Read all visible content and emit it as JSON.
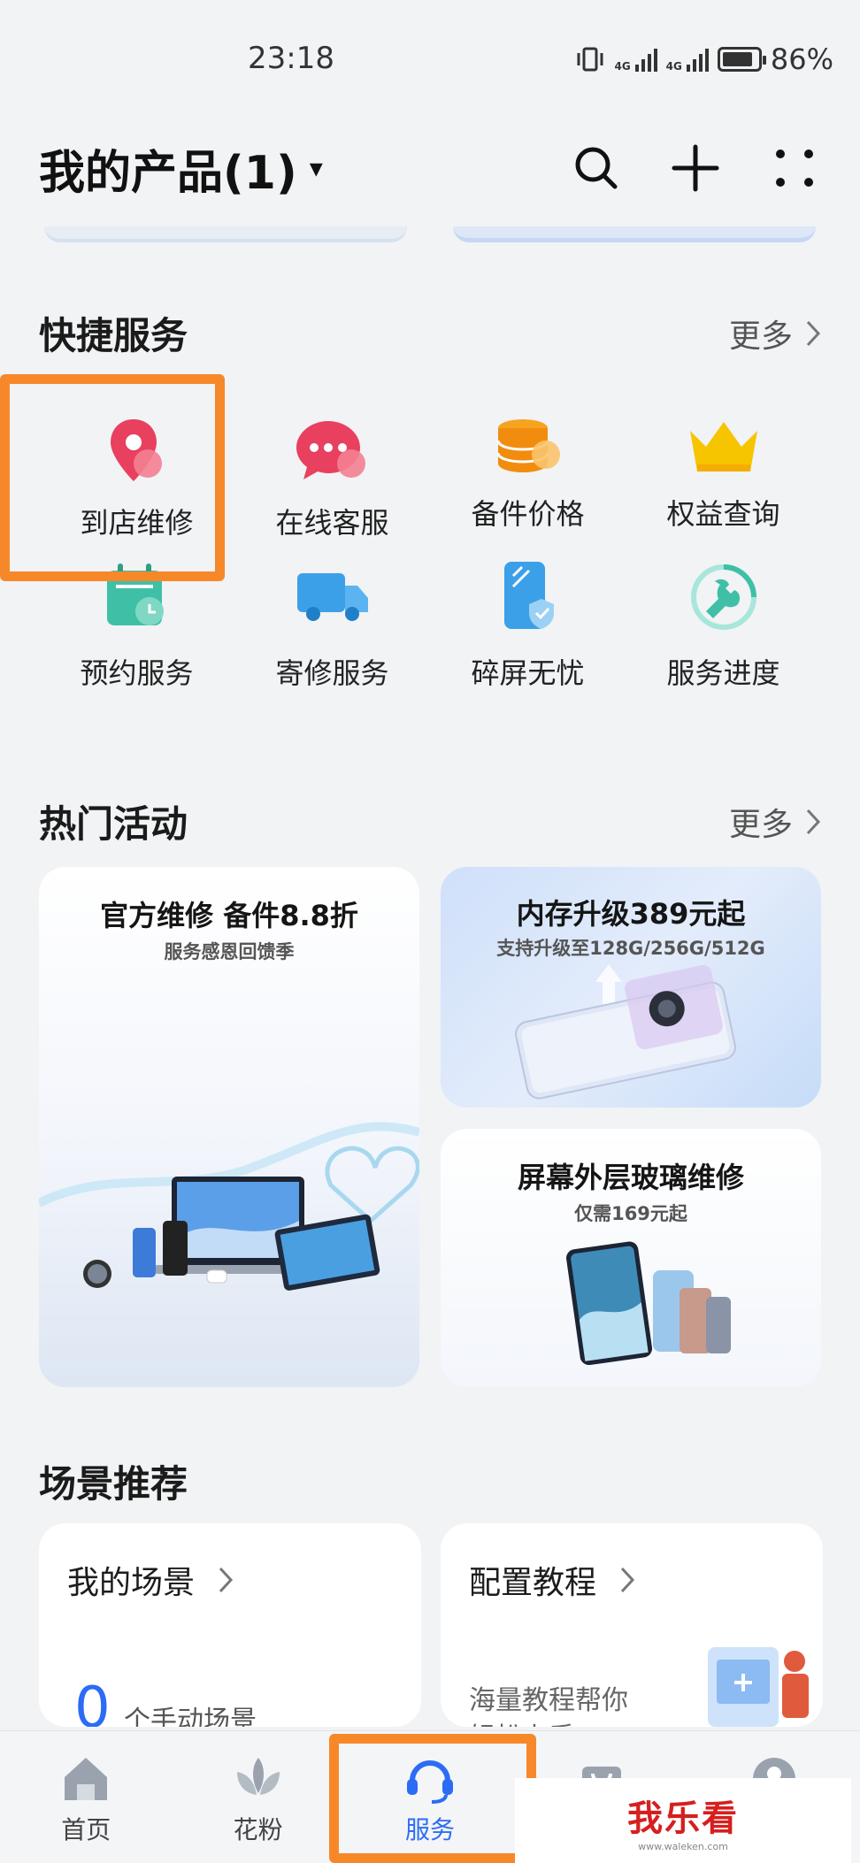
{
  "status_bar": {
    "time": "23:18",
    "net1": "4G",
    "net2": "4G",
    "battery": "86%",
    "battery_level": 0.86
  },
  "header": {
    "title": "我的产品(1)",
    "caret": "▾"
  },
  "quick_services": {
    "title": "快捷服务",
    "more": "更多",
    "items": [
      {
        "label": "到店维修",
        "icon": "map-pin-icon"
      },
      {
        "label": "在线客服",
        "icon": "chat-bubble-icon"
      },
      {
        "label": "备件价格",
        "icon": "coin-stack-icon"
      },
      {
        "label": "权益查询",
        "icon": "crown-icon"
      },
      {
        "label": "预约服务",
        "icon": "calendar-clock-icon"
      },
      {
        "label": "寄修服务",
        "icon": "delivery-truck-icon"
      },
      {
        "label": "碎屏无忧",
        "icon": "phone-shield-icon"
      },
      {
        "label": "服务进度",
        "icon": "wrench-progress-icon"
      }
    ]
  },
  "hot_activities": {
    "title": "热门活动",
    "more": "更多",
    "cards": [
      {
        "title": "官方维修 备件8.8折",
        "subtitle": "服务感恩回馈季"
      },
      {
        "title": "内存升级389元起",
        "subtitle": "支持升级至128G/256G/512G"
      },
      {
        "title": "屏幕外层玻璃维修",
        "subtitle": "仅需169元起"
      }
    ]
  },
  "scenes": {
    "title": "场景推荐",
    "cards": [
      {
        "title": "我的场景",
        "count": "0",
        "desc": "个手动场景"
      },
      {
        "title": "配置教程",
        "desc": "海量教程帮你\n轻松上手"
      }
    ]
  },
  "bottom_nav": {
    "items": [
      {
        "label": "首页",
        "icon": "home-icon"
      },
      {
        "label": "花粉",
        "icon": "lotus-icon"
      },
      {
        "label": "服务",
        "icon": "headset-icon"
      },
      {
        "label": "",
        "icon": "shopping-bag-icon"
      },
      {
        "label": "",
        "icon": "profile-icon"
      }
    ]
  },
  "watermark": {
    "text": "我乐看",
    "url": "www.waleken.com"
  },
  "colors": {
    "accent_blue": "#2c6cf5",
    "highlight_orange": "#f7882a",
    "background": "#f1f3f5"
  }
}
